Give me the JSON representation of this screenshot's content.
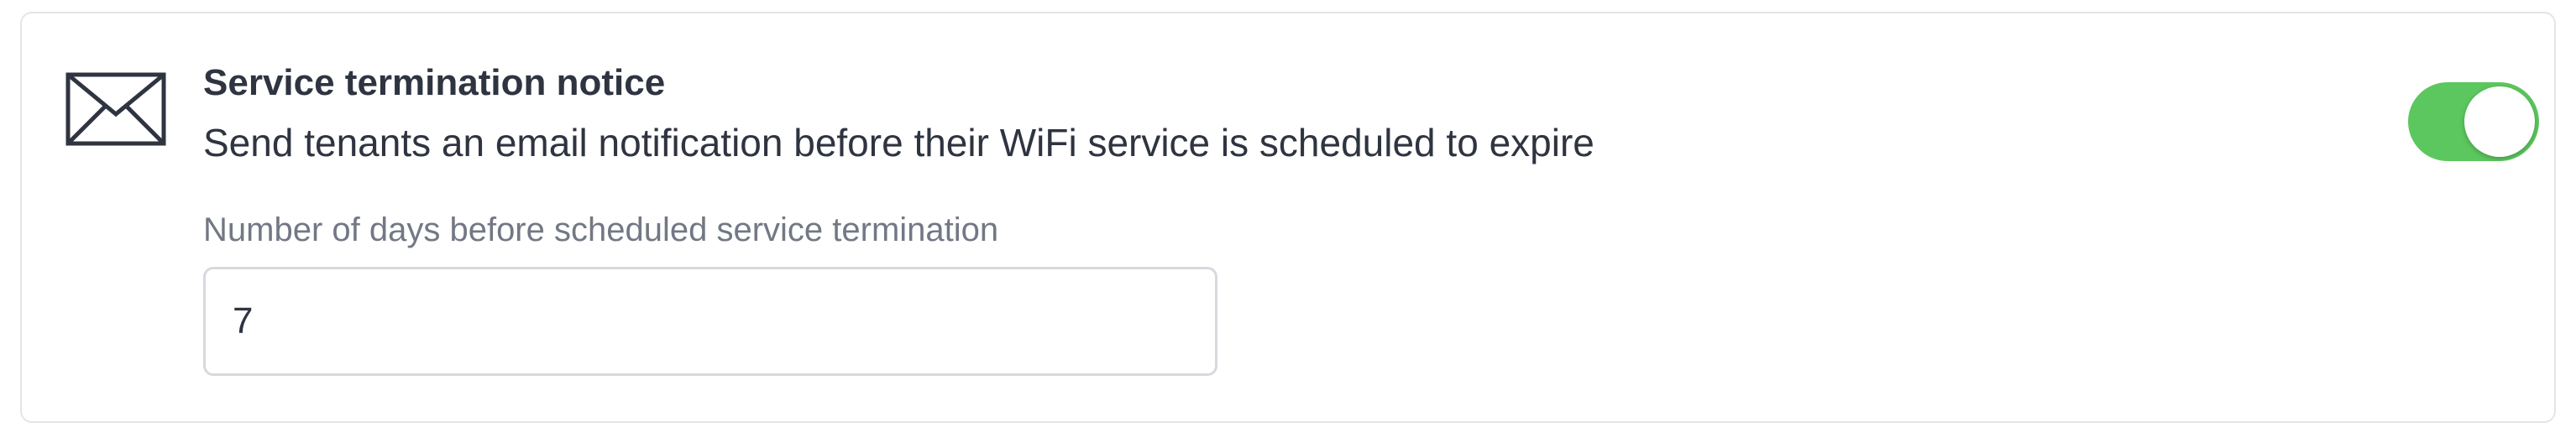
{
  "notification": {
    "icon": "envelope-icon",
    "title": "Service termination notice",
    "description": "Send tenants an email notification before their WiFi service is scheduled to expire",
    "enabled": true,
    "toggle_color": "#5cc75e"
  },
  "days_field": {
    "label": "Number of days before scheduled service termination",
    "value": "7"
  }
}
